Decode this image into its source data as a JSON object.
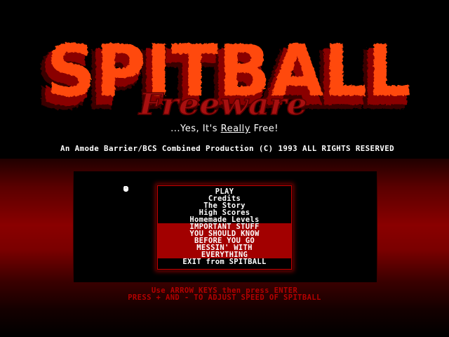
{
  "logo": {
    "title": "SPITBALL",
    "subtitle": "Freeware"
  },
  "tagline": {
    "prefix": "...Yes, It's ",
    "emphasis": "Really",
    "suffix": " Free!"
  },
  "credits": "An Amode Barrier/BCS Combined Production (C) 1993 ALL RIGHTS RESERVED",
  "menu": {
    "items": [
      {
        "label": "PLAY",
        "highlighted": false
      },
      {
        "label": "Credits",
        "highlighted": false
      },
      {
        "label": "The Story",
        "highlighted": false
      },
      {
        "label": "High Scores",
        "highlighted": false
      },
      {
        "label": "Homemade Levels",
        "highlighted": false
      },
      {
        "label": "IMPORTANT STUFF",
        "highlighted": true
      },
      {
        "label": "YOU SHOULD KNOW",
        "highlighted": true
      },
      {
        "label": "BEFORE YOU GO",
        "highlighted": true
      },
      {
        "label": "MESSIN' WITH",
        "highlighted": true
      },
      {
        "label": "EVERYTHING",
        "highlighted": true
      },
      {
        "label": "EXIT from SPITBALL",
        "highlighted": false
      }
    ]
  },
  "instructions": {
    "line1": "Use ARROW KEYS then press ENTER",
    "line2": "PRESS + AND - TO ADJUST SPEED OF SPITBALL"
  },
  "colors": {
    "logo_red": "#ff4a10",
    "logo_shadow": "#8a0000",
    "subtitle_red": "#a81010",
    "highlight": "#a20000",
    "instruction_text": "#b30000"
  }
}
